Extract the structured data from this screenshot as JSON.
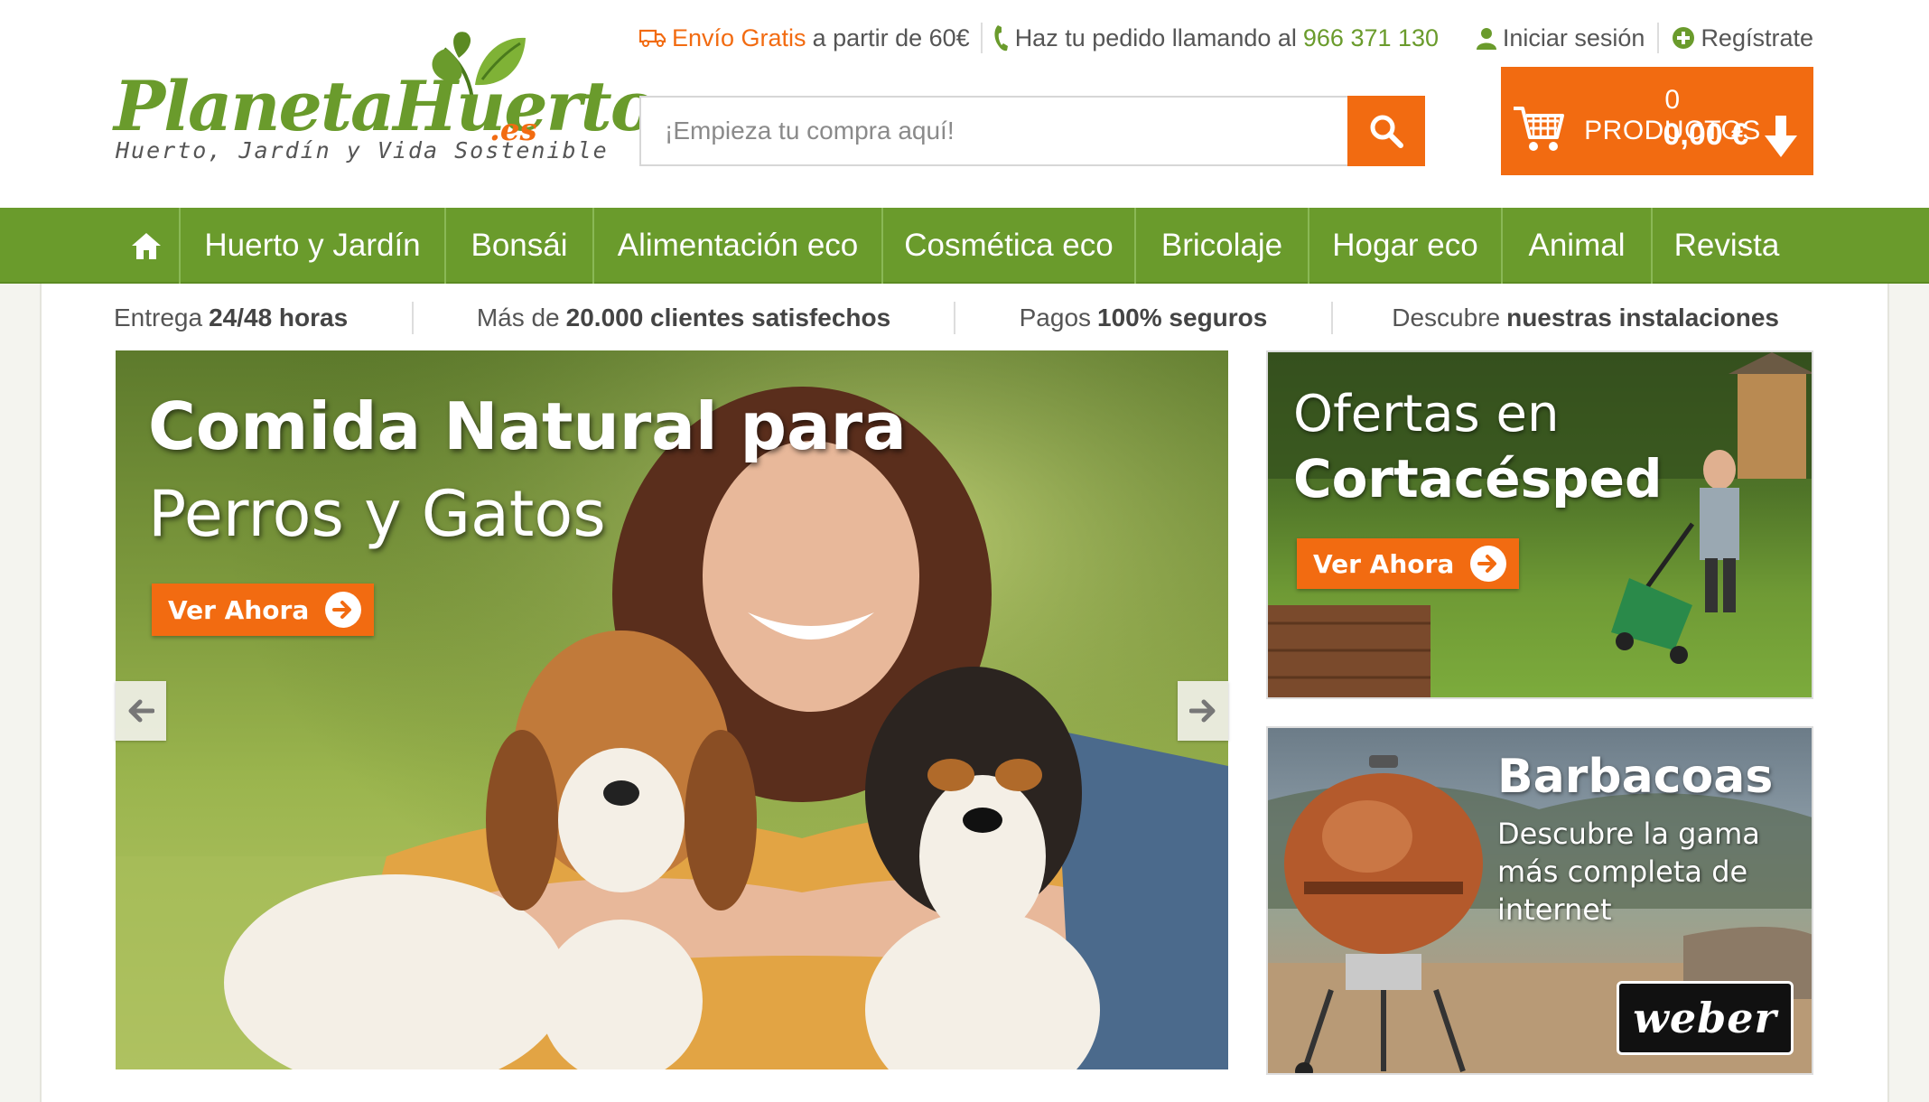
{
  "brand": {
    "name": "PlanetaHuerto",
    "tld": ".es",
    "tagline": "Huerto, Jardín y Vida Sostenible",
    "green": "#6a9b2c",
    "orange": "#f26b11"
  },
  "topbar": {
    "shipping_highlight": "Envío Gratis",
    "shipping_text": "a partir de 60€",
    "phone_text": "Haz tu pedido llamando al",
    "phone_number": "966 371 130",
    "login_label": "Iniciar sesión",
    "register_label": "Regístrate"
  },
  "search": {
    "placeholder": "¡Empieza tu compra aquí!",
    "value": ""
  },
  "cart": {
    "count_label": "0 PRODUCTOS",
    "total": "0,00 €"
  },
  "nav": {
    "items": [
      {
        "label": "Huerto y Jardín"
      },
      {
        "label": "Bonsái"
      },
      {
        "label": "Alimentación eco"
      },
      {
        "label": "Cosmética eco"
      },
      {
        "label": "Bricolaje"
      },
      {
        "label": "Hogar eco"
      },
      {
        "label": "Animal"
      },
      {
        "label": "Revista"
      }
    ]
  },
  "benefits": [
    {
      "plain": "Entrega",
      "bold": "24/48 horas"
    },
    {
      "plain": "Más de",
      "bold": "20.000 clientes satisfechos"
    },
    {
      "plain": "Pagos",
      "bold": "100% seguros"
    },
    {
      "plain": "Descubre",
      "bold": "nuestras instalaciones"
    }
  ],
  "hero": {
    "title_line1": "Comida Natural para",
    "title_line2": "Perros y Gatos",
    "cta": "Ver Ahora"
  },
  "banners": {
    "mower": {
      "line1": "Ofertas en",
      "line2": "Cortacésped",
      "cta": "Ver Ahora"
    },
    "bbq": {
      "title": "Barbacoas",
      "subtitle": "Descubre la gama más completa de internet",
      "logo": "weber"
    }
  },
  "icons": {
    "truck": "truck-icon",
    "phone": "phone-icon",
    "user": "user-icon",
    "plus": "plus-circle-icon",
    "search": "search-icon",
    "cart": "cart-icon",
    "arrow_down": "arrow-down-icon",
    "home": "home-icon",
    "arrow_left": "arrow-left-icon",
    "arrow_right": "arrow-right-icon"
  }
}
